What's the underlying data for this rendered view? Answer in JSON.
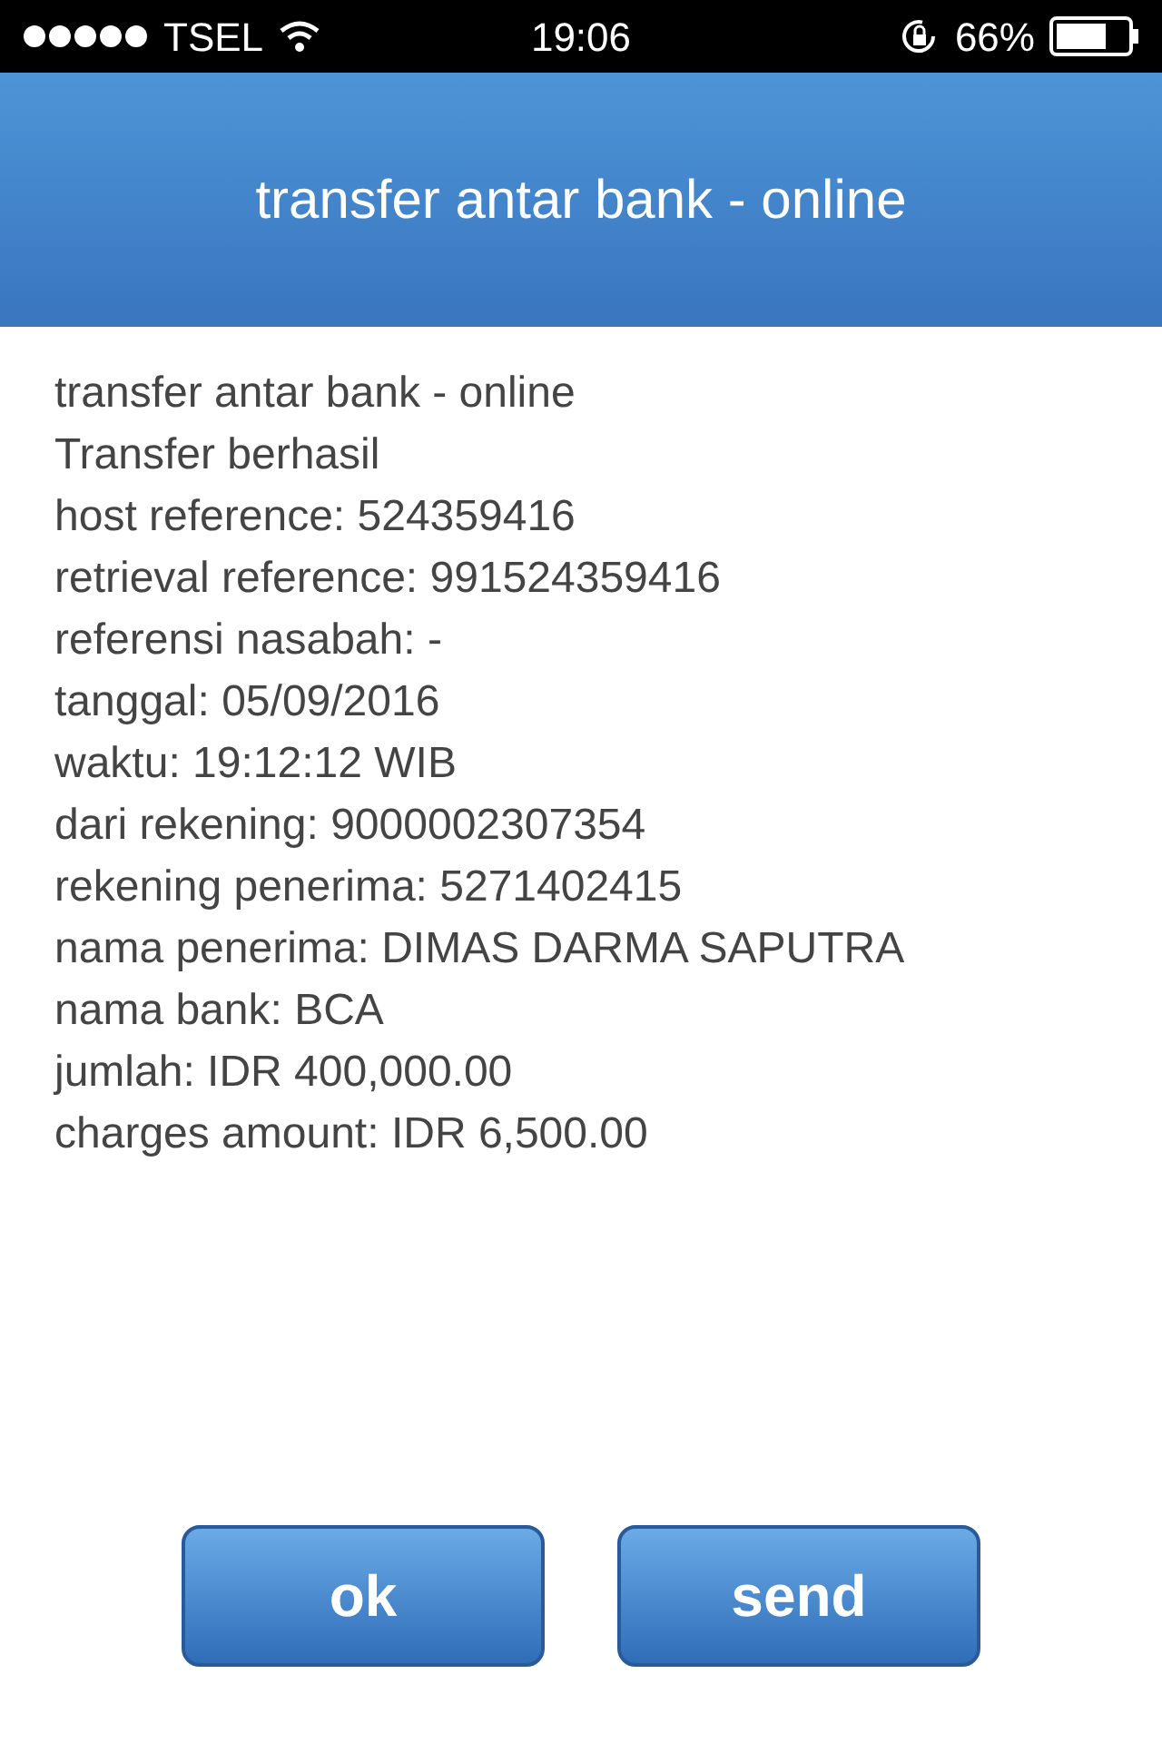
{
  "status_bar": {
    "carrier": "TSEL",
    "time": "19:06",
    "battery": "66%"
  },
  "header": {
    "title": "transfer antar bank - online"
  },
  "lines": [
    "transfer antar bank - online",
    "Transfer berhasil",
    "host reference: 524359416",
    "retrieval reference: 991524359416",
    "referensi nasabah: -",
    "tanggal: 05/09/2016",
    "waktu: 19:12:12 WIB",
    "dari rekening: 9000002307354",
    "rekening penerima: 5271402415",
    "nama penerima: DIMAS DARMA SAPUTRA",
    "nama bank: BCA",
    "jumlah: IDR 400,000.00",
    "charges amount: IDR 6,500.00"
  ],
  "buttons": [
    "ok",
    "send"
  ]
}
